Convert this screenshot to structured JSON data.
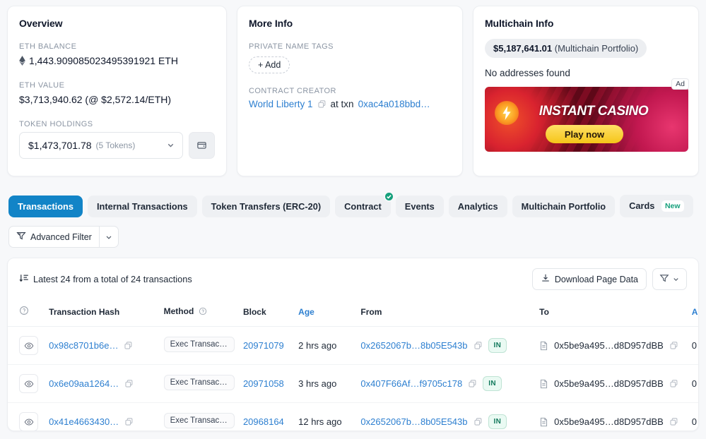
{
  "overview": {
    "title": "Overview",
    "eth_balance_label": "ETH BALANCE",
    "eth_balance_value": "1,443.909085023495391921 ETH",
    "eth_value_label": "ETH VALUE",
    "eth_value_value": "$3,713,940.62 (@ $2,572.14/ETH)",
    "token_holdings_label": "TOKEN HOLDINGS",
    "token_holdings_amount": "$1,473,701.78",
    "token_holdings_count": "(5 Tokens)"
  },
  "more_info": {
    "title": "More Info",
    "private_name_tags_label": "PRIVATE NAME TAGS",
    "add_button": "+ Add",
    "contract_creator_label": "CONTRACT CREATOR",
    "creator_name": "World Liberty 1",
    "at_txn_text": "at txn",
    "creator_txn": "0xac4a018bbd…"
  },
  "multichain": {
    "title": "Multichain Info",
    "portfolio_amount": "$5,187,641.01",
    "portfolio_suffix": "(Multichain Portfolio)",
    "no_addresses": "No addresses found",
    "ad_label": "Ad",
    "ad_title": "INSTANT CASINO",
    "ad_cta": "Play now"
  },
  "tabs": [
    {
      "label": "Transactions",
      "active": true
    },
    {
      "label": "Internal Transactions",
      "active": false
    },
    {
      "label": "Token Transfers (ERC-20)",
      "active": false
    },
    {
      "label": "Contract",
      "active": false,
      "badge": "check"
    },
    {
      "label": "Events",
      "active": false
    },
    {
      "label": "Analytics",
      "active": false
    },
    {
      "label": "Multichain Portfolio",
      "active": false
    },
    {
      "label": "Cards",
      "active": false,
      "tag": "New"
    }
  ],
  "advanced_filter": {
    "label": "Advanced Filter"
  },
  "table": {
    "summary": "Latest 24 from a total of 24 transactions",
    "download_label": "Download Page Data",
    "columns": {
      "eye": "",
      "hash": "Transaction Hash",
      "method": "Method",
      "block": "Block",
      "age": "Age",
      "from": "From",
      "to": "To",
      "amount": "A"
    },
    "rows": [
      {
        "hash": "0x98c8701b6e…",
        "method": "Exec Transact…",
        "block": "20971079",
        "age": "2 hrs ago",
        "from": "0x2652067b…8b05E543b",
        "direction": "IN",
        "to": "0x5be9a495…d8D957dBB",
        "amount": "0"
      },
      {
        "hash": "0x6e09aa1264…",
        "method": "Exec Transact…",
        "block": "20971058",
        "age": "3 hrs ago",
        "from": "0x407F66Af…f9705c178",
        "direction": "IN",
        "to": "0x5be9a495…d8D957dBB",
        "amount": "0"
      },
      {
        "hash": "0x41e4663430…",
        "method": "Exec Transact…",
        "block": "20968164",
        "age": "12 hrs ago",
        "from": "0x2652067b…8b05E543b",
        "direction": "IN",
        "to": "0x5be9a495…d8D957dBB",
        "amount": "0"
      }
    ]
  },
  "colors": {
    "accent_blue": "#1284c7",
    "link_blue": "#2d7fd0",
    "green": "#16a07c",
    "page_bg": "#f7f8fa"
  }
}
